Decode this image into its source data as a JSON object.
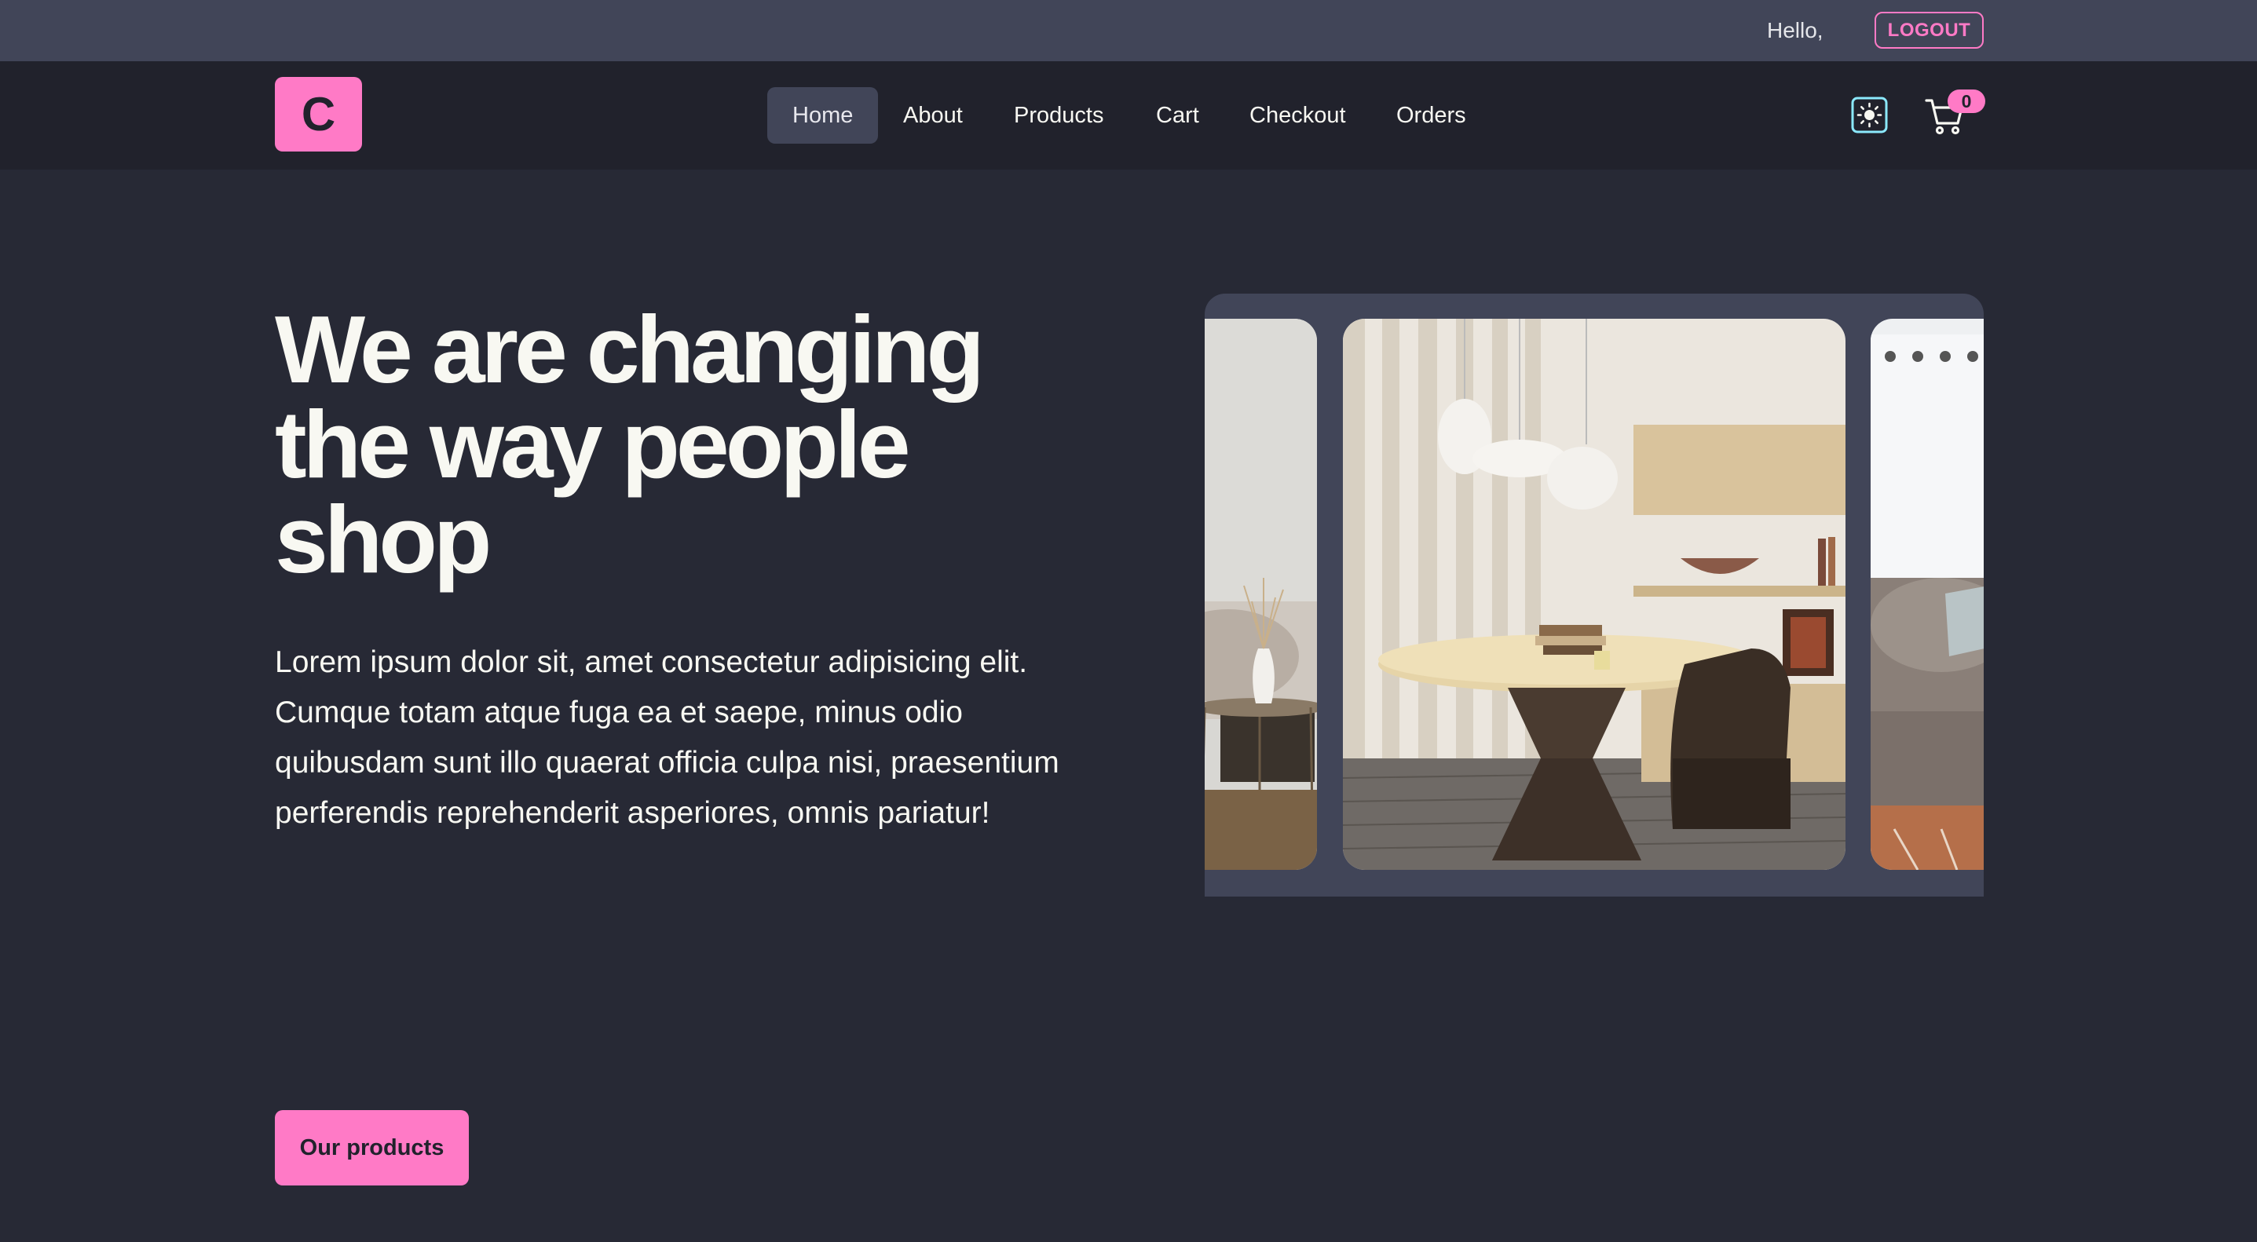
{
  "topbar": {
    "greeting": "Hello,",
    "logout_label": "LOGOUT"
  },
  "navbar": {
    "logo_letter": "C",
    "links": [
      {
        "label": "Home",
        "active": true
      },
      {
        "label": "About",
        "active": false
      },
      {
        "label": "Products",
        "active": false
      },
      {
        "label": "Cart",
        "active": false
      },
      {
        "label": "Checkout",
        "active": false
      },
      {
        "label": "Orders",
        "active": false
      }
    ],
    "theme_icon": "sun-icon",
    "cart_icon": "cart-icon",
    "cart_count": "0"
  },
  "hero": {
    "title": "We are changing the way people shop",
    "description": "Lorem ipsum dolor sit, amet consectetur adipisicing elit. Cumque totam atque fuga ea et saepe, minus odio quibusdam sunt illo quaerat officia culpa nisi, praesentium perferendis reprehenderit asperiores, omnis pariatur!",
    "cta_label": "Our products"
  },
  "carousel": {
    "slides": [
      "living-room-vase",
      "dining-table-lamps",
      "sofa-window"
    ]
  },
  "colors": {
    "accent": "#ff7ac6",
    "topbar": "#414558",
    "navbar": "#21222c",
    "background": "#272935"
  }
}
